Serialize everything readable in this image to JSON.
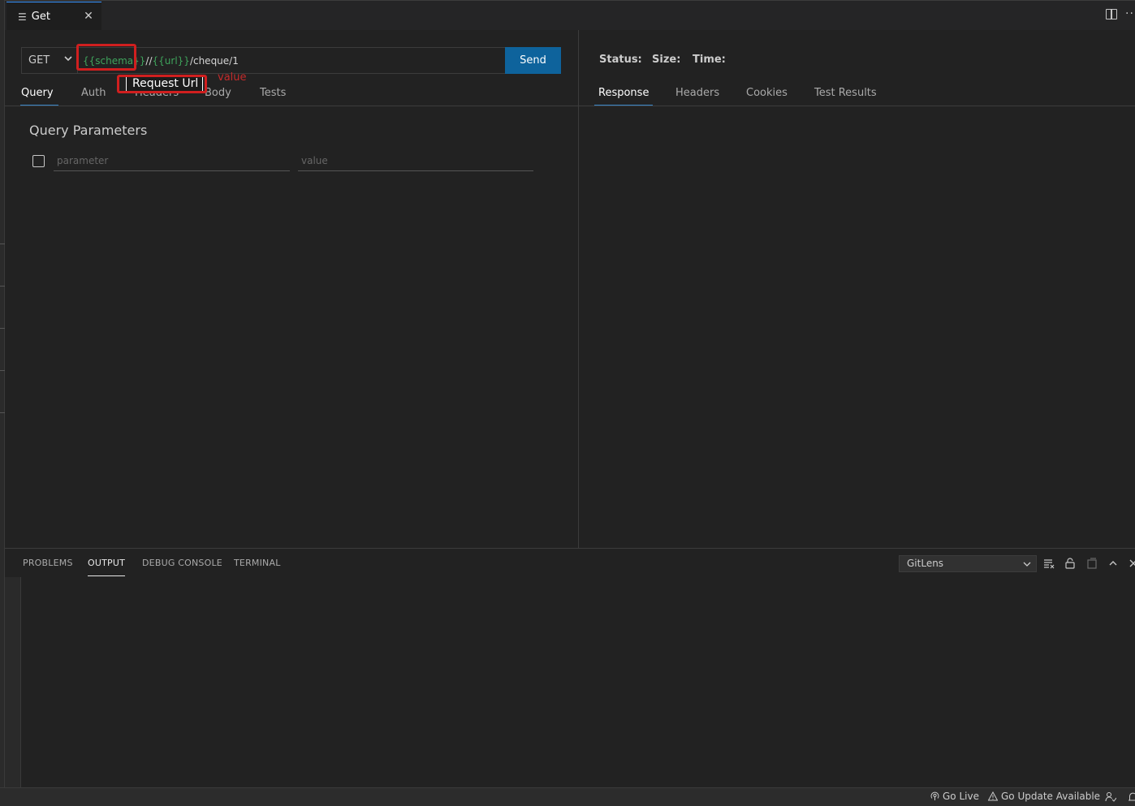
{
  "tab": {
    "title": "Get",
    "icon": "hamburger-icon",
    "close_icon": "close-icon"
  },
  "request": {
    "method": "GET",
    "url_parts": [
      {
        "text": "{{schema}}",
        "kind": "variable"
      },
      {
        "text": "//",
        "kind": "plain"
      },
      {
        "text": "{{url}}",
        "kind": "variable"
      },
      {
        "text": "/cheque/1",
        "kind": "plain"
      }
    ],
    "send_label": "Send",
    "tabs": [
      "Query",
      "Auth",
      "Headers",
      "Body",
      "Tests"
    ],
    "active_tab": "Query",
    "query_title": "Query Parameters",
    "param_placeholder": "parameter",
    "value_placeholder": "value"
  },
  "annotations": {
    "tooltip": "Request Url",
    "value_label": "value",
    "highlight_color": "#d01f1f"
  },
  "response": {
    "status_label": "Status:",
    "size_label": "Size:",
    "time_label": "Time:",
    "tabs": [
      "Response",
      "Headers",
      "Cookies",
      "Test Results"
    ],
    "active_tab": "Response"
  },
  "panel": {
    "tabs": [
      "PROBLEMS",
      "OUTPUT",
      "DEBUG CONSOLE",
      "TERMINAL"
    ],
    "active_tab": "OUTPUT",
    "output_channel": "GitLens"
  },
  "statusbar": {
    "go_live": "Go Live",
    "update": "Go Update Available"
  },
  "colors": {
    "accent": "#0e639c",
    "variable": "#3fa45c",
    "tab_underline": "#3a86c8"
  }
}
